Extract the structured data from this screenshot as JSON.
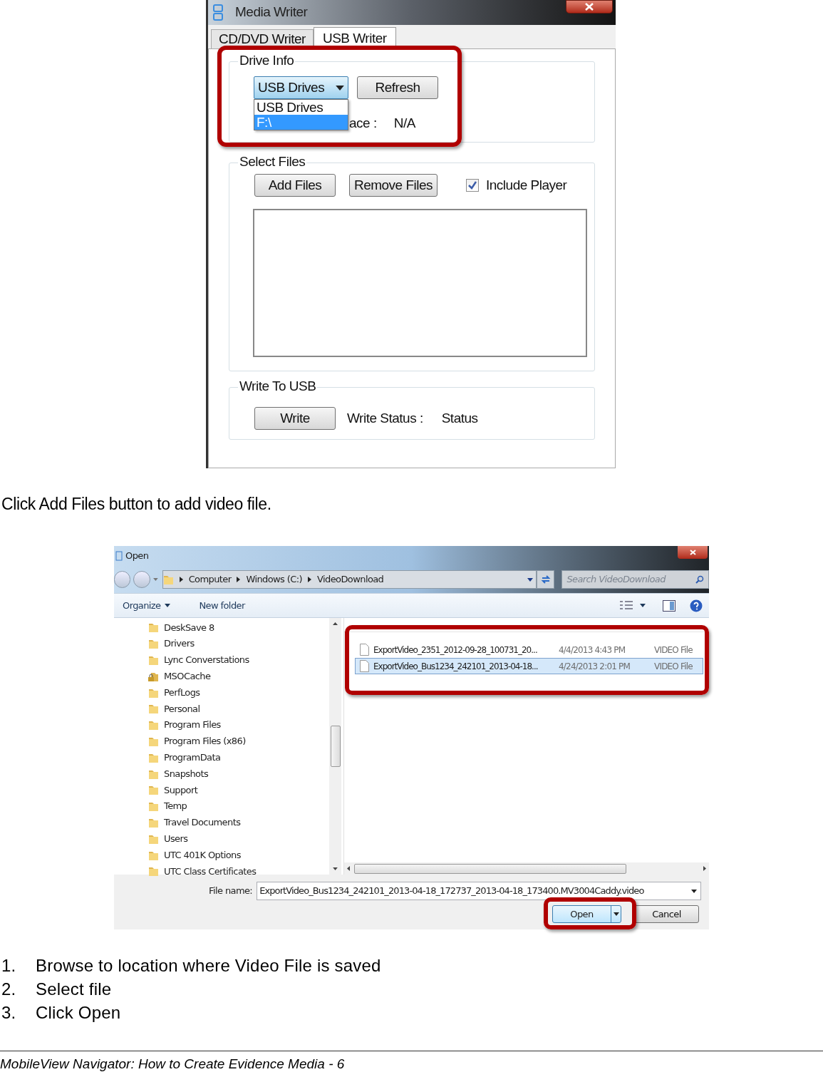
{
  "media_writer": {
    "title": "Media Writer",
    "tabs": [
      {
        "label": "CD/DVD Writer",
        "selected": false
      },
      {
        "label": "USB Writer",
        "selected": true
      }
    ],
    "drive_info": {
      "legend": "Drive Info",
      "dropdown": {
        "value": "USB Drives",
        "expanded": true,
        "options": [
          {
            "label": "USB Drives",
            "highlighted": false
          },
          {
            "label": "F:\\",
            "highlighted": true
          }
        ]
      },
      "refresh_button": "Refresh",
      "space_label": "ace :",
      "space_value": "N/A"
    },
    "select_files": {
      "legend": "Select Files",
      "buttons": [
        "Add Files",
        "Remove Files"
      ],
      "include_player": {
        "label": "Include Player",
        "checked": true
      }
    },
    "write_to_usb": {
      "legend": "Write To USB",
      "button": "Write",
      "status_label": "Write Status :",
      "status_value": "Status"
    }
  },
  "caption": "Click Add Files button to add video file.",
  "open_dialog": {
    "title": "Open",
    "breadcrumb": [
      "Computer",
      "Windows (C:)",
      "VideoDownload"
    ],
    "search": {
      "placeholder": "Search VideoDownload"
    },
    "toolbar": {
      "organize": "Organize",
      "new_folder": "New folder"
    },
    "folders": [
      {
        "name": "DeskSave 8",
        "locked": false
      },
      {
        "name": "Drivers",
        "locked": false
      },
      {
        "name": "Lync Converstations",
        "locked": false
      },
      {
        "name": "MSOCache",
        "locked": true
      },
      {
        "name": "PerfLogs",
        "locked": false
      },
      {
        "name": "Personal",
        "locked": false
      },
      {
        "name": "Program Files",
        "locked": false
      },
      {
        "name": "Program Files (x86)",
        "locked": false
      },
      {
        "name": "ProgramData",
        "locked": false
      },
      {
        "name": "Snapshots",
        "locked": false
      },
      {
        "name": "Support",
        "locked": false
      },
      {
        "name": "Temp",
        "locked": false
      },
      {
        "name": "Travel Documents",
        "locked": false
      },
      {
        "name": "Users",
        "locked": false
      },
      {
        "name": "UTC 401K Options",
        "locked": false
      },
      {
        "name": "UTC Class Certificates",
        "locked": false
      }
    ],
    "files": [
      {
        "name": "ExportVideo_2351_2012-09-28_100731_20...",
        "date": "4/4/2013 4:43 PM",
        "type": "VIDEO File",
        "selected": false
      },
      {
        "name": "ExportVideo_Bus1234_242101_2013-04-18...",
        "date": "4/24/2013 2:01 PM",
        "type": "VIDEO File",
        "selected": true
      }
    ],
    "file_name_label": "File name:",
    "file_name_value": "ExportVideo_Bus1234_242101_2013-04-18_172737_2013-04-18_173400.MV3004Caddy.video",
    "open_button": "Open",
    "cancel_button": "Cancel"
  },
  "steps": [
    {
      "number": "1.",
      "text": "Browse to location where Video File is saved"
    },
    {
      "number": "2.",
      "text": "Select file"
    },
    {
      "number": "3.",
      "text": "Click Open"
    }
  ],
  "footer": "MobileView Navigator: How to Create Evidence Media - 6"
}
